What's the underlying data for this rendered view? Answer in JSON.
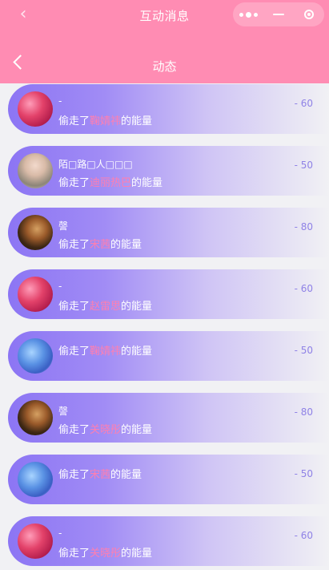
{
  "top_bar": {
    "back_icon": "‹",
    "title": "互动消息"
  },
  "sub_header": {
    "title": "动态"
  },
  "colors": {
    "header_pink": "#ff8cb3",
    "card_purple": "#8c75f4",
    "highlight_pink": "#ff7fb0",
    "amount_color": "#8f82e6"
  },
  "messages": [
    {
      "avatar": "rose",
      "name": "-",
      "prefix": "偷走了",
      "target": "鞠婧祎",
      "suffix": "的能量",
      "amount": "- 60"
    },
    {
      "avatar": "girl",
      "name": "陌□路□人□□□",
      "prefix": "偷走了",
      "target": "迪丽热巴",
      "suffix": "的能量",
      "amount": "- 50"
    },
    {
      "avatar": "dark",
      "name": "謦",
      "prefix": "偷走了",
      "target": "宋茜",
      "suffix": "的能量",
      "amount": "- 80"
    },
    {
      "avatar": "rose",
      "name": "-",
      "prefix": "偷走了",
      "target": "赵雷思",
      "suffix": "的能量",
      "amount": "- 60"
    },
    {
      "avatar": "blue",
      "name": "",
      "prefix": "偷走了",
      "target": "鞠婧祎",
      "suffix": "的能量",
      "amount": "- 50"
    },
    {
      "avatar": "dark",
      "name": "謦",
      "prefix": "偷走了",
      "target": "关晓彤",
      "suffix": "的能量",
      "amount": "- 80"
    },
    {
      "avatar": "blue",
      "name": "",
      "prefix": "偷走了",
      "target": "宋茜",
      "suffix": "的能量",
      "amount": "- 50"
    },
    {
      "avatar": "rose",
      "name": "-",
      "prefix": "偷走了",
      "target": "关晓彤",
      "suffix": "的能量",
      "amount": "- 60"
    }
  ]
}
